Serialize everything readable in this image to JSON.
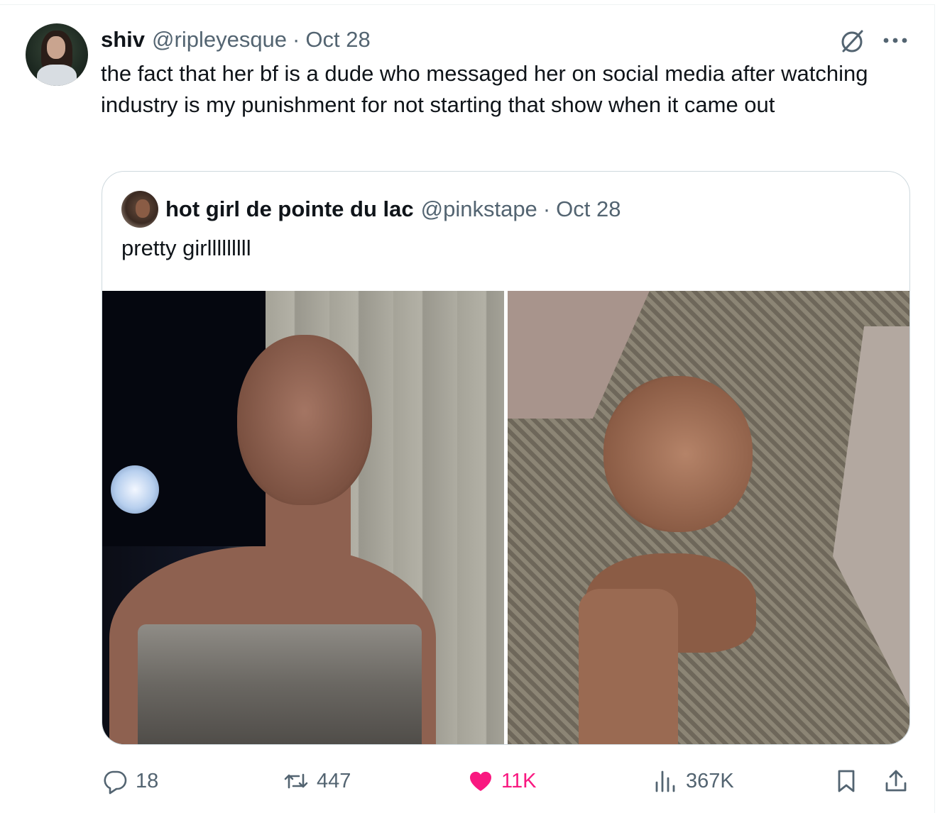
{
  "tweet": {
    "author_name": "shiv",
    "author_handle": "@ripleyesque",
    "separator": "·",
    "date": "Oct 28",
    "text": "the fact that her bf is a dude who messaged her on social media after watching industry is my punishment for not starting that show when it came out"
  },
  "quote": {
    "author_name": "hot girl de pointe du lac",
    "author_handle": "@pinkstape",
    "separator": "·",
    "date": "Oct 28",
    "text": "pretty girlllllllll"
  },
  "actions": {
    "replies": "18",
    "reposts": "447",
    "likes": "11K",
    "views": "367K"
  },
  "colors": {
    "text": "#0f1419",
    "muted": "#536471",
    "like": "#f91880",
    "border": "#cfd9de"
  },
  "icons": [
    "grok-icon",
    "more-icon",
    "reply-icon",
    "repost-icon",
    "heart-icon",
    "views-icon",
    "bookmark-icon",
    "share-icon"
  ]
}
